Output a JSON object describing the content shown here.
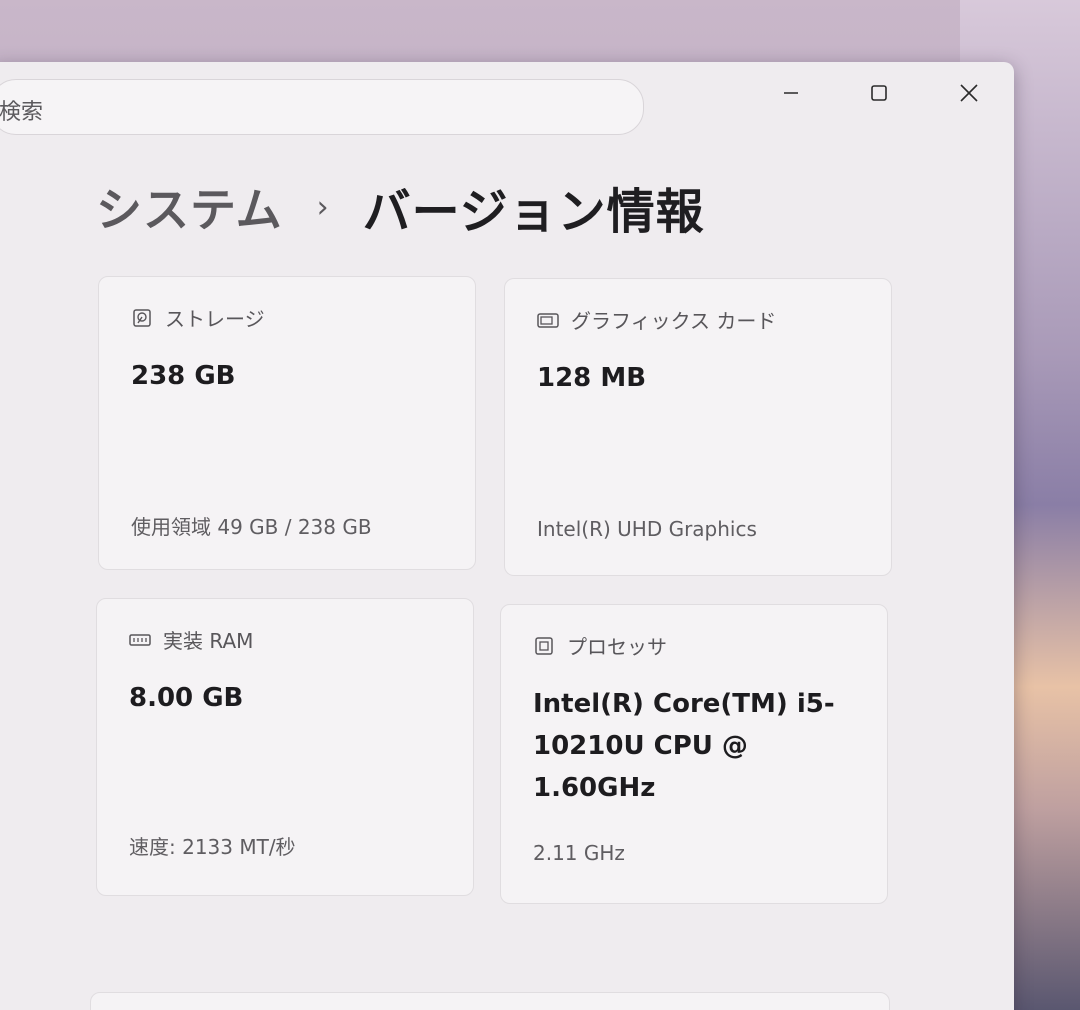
{
  "search": {
    "placeholder": "検索",
    "icon": "search-icon"
  },
  "window_controls": {
    "minimize": "minimize-icon",
    "maximize": "maximize-icon",
    "close": "close-icon"
  },
  "breadcrumb": {
    "parent": "システム",
    "separator": "›",
    "current": "バージョン情報"
  },
  "specs": [
    {
      "icon": "storage-icon",
      "label": "ストレージ",
      "value": "238 GB",
      "detail": "使用領域 49 GB / 238 GB"
    },
    {
      "icon": "graphics-card-icon",
      "label": "グラフィックス カード",
      "value": "128 MB",
      "detail": "Intel(R) UHD Graphics"
    },
    {
      "icon": "ram-icon",
      "label": "実装 RAM",
      "value": "8.00 GB",
      "detail": "速度: 2133 MT/秒"
    },
    {
      "icon": "processor-icon",
      "label": "プロセッサ",
      "value": "Intel(R) Core(TM) i5-10210U CPU @ 1.60GHz",
      "detail": "2.11 GHz"
    }
  ]
}
